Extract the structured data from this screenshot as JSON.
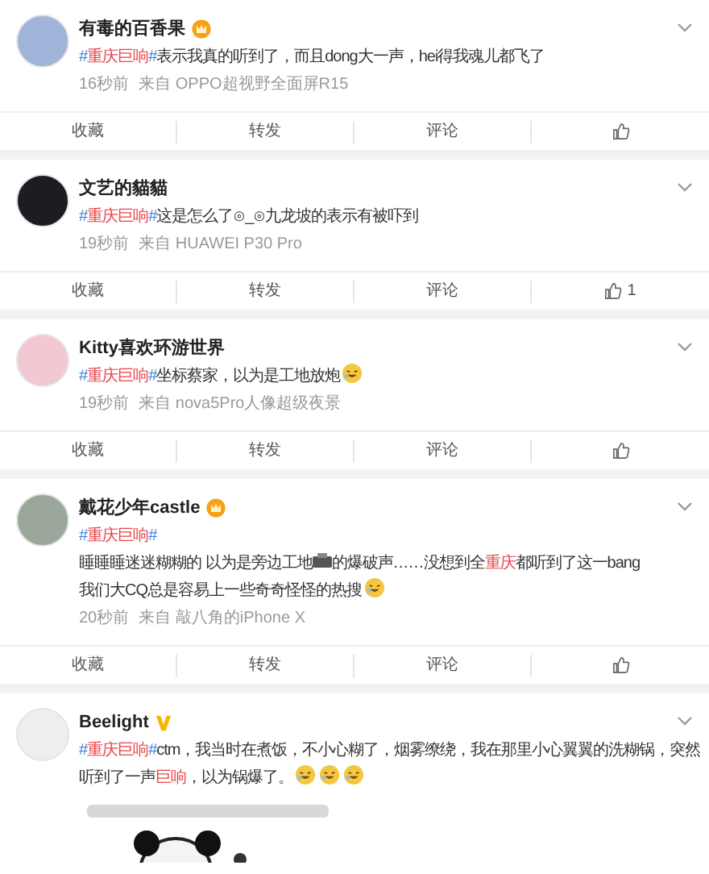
{
  "posts": [
    {
      "author": "有毒的百香果",
      "badge": {
        "kind": "crown"
      },
      "lines": [
        [
          {
            "kind": "topic",
            "parts": [
              "#",
              "重庆巨响",
              "#"
            ]
          },
          {
            "kind": "plain",
            "text": "表示我真的听到了，而且dong大一声，hei得我魂儿都飞了"
          }
        ]
      ],
      "time": "16秒前",
      "source": "来自 OPPO超视野全面屏R15",
      "actions": [
        "收藏",
        "转发",
        "评论"
      ]
    },
    {
      "author": "文艺的貓貓",
      "lines": [
        [
          {
            "kind": "topic",
            "parts": [
              "#",
              "重庆巨响",
              "#"
            ]
          },
          {
            "kind": "plain",
            "text": "这是怎么了⊙_⊙九龙坡的表示有被吓到"
          }
        ]
      ],
      "time": "19秒前",
      "source": "来自 HUAWEI P30 Pro",
      "actions": [
        "收藏",
        "转发",
        "评论"
      ],
      "likes": "1"
    },
    {
      "author": "Kitty喜欢环游世界",
      "lines": [
        [
          {
            "kind": "topic",
            "parts": [
              "#",
              "重庆巨响",
              "#"
            ]
          },
          {
            "kind": "plain",
            "text": "坐标蔡家，以为是工地放炮"
          },
          {
            "kind": "emoji"
          }
        ]
      ],
      "time": "19秒前",
      "source": "来自 nova5Pro人像超级夜景",
      "actions": [
        "收藏",
        "转发",
        "评论"
      ]
    },
    {
      "author": "戴花少年castle",
      "badge": {
        "kind": "crown"
      },
      "lines": [
        [
          {
            "kind": "topic",
            "parts": [
              "#",
              "重庆巨响",
              "#"
            ]
          }
        ],
        [
          {
            "kind": "plain",
            "text": "睡睡睡迷迷糊糊的 以为是旁边工地"
          },
          {
            "kind": "sticker"
          },
          {
            "kind": "plain",
            "text": "的爆破声……没想到全"
          },
          {
            "kind": "keyword",
            "text": "重庆"
          },
          {
            "kind": "plain",
            "text": "都听到了这一bang"
          }
        ],
        [
          {
            "kind": "plain",
            "text": "我们大CQ总是容易上一些奇奇怪怪的热搜"
          },
          {
            "kind": "emoji"
          }
        ]
      ],
      "time": "20秒前",
      "source": "来自 敲八角的iPhone X",
      "actions": [
        "收藏",
        "转发",
        "评论"
      ]
    },
    {
      "author": "Beelight",
      "badge": {
        "kind": "verified"
      },
      "lines": [
        [
          {
            "kind": "topic",
            "parts": [
              "#",
              "重庆巨响",
              "#"
            ]
          },
          {
            "kind": "plain",
            "text": "ctm，我当时在煮饭，不小心糊了，烟雾缭绕，我在那里小心翼翼的洗糊锅，突然"
          }
        ],
        [
          {
            "kind": "plain",
            "text": "听到了一声"
          },
          {
            "kind": "keyword",
            "text": "巨响"
          },
          {
            "kind": "plain",
            "text": "，以为锅爆了。"
          },
          {
            "kind": "emoji"
          },
          {
            "kind": "emoji"
          },
          {
            "kind": "emoji"
          }
        ]
      ],
      "image": {
        "kind": "picture"
      }
    }
  ]
}
